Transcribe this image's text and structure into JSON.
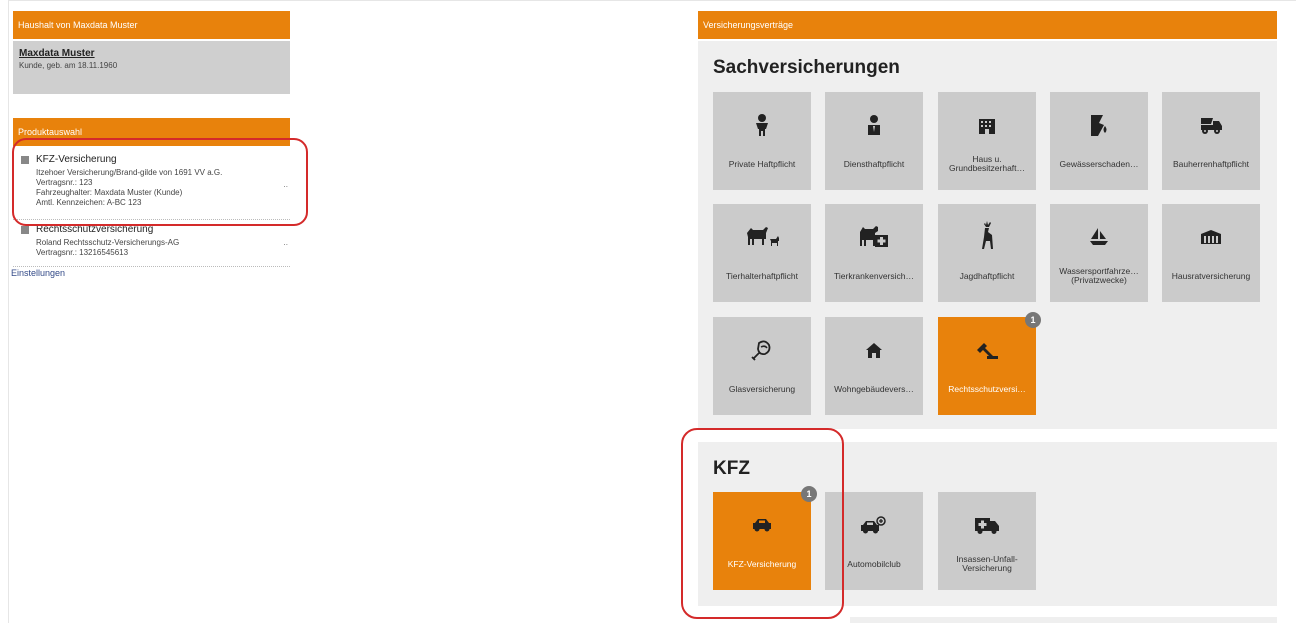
{
  "household_header": "Haushalt von Maxdata Muster",
  "customer": {
    "name": "Maxdata Muster",
    "subtitle": "Kunde, geb. am 18.11.1960"
  },
  "product_header": "Produktauswahl",
  "products": [
    {
      "title": "KFZ-Versicherung",
      "lines": [
        "Itzehoer Versicherung/Brand-gilde von 1691 VV a.G.",
        "Vertragsnr.: 123",
        "Fahrzeughalter: Maxdata Muster (Kunde)",
        "Amtl. Kennzeichen: A-BC 123"
      ],
      "more": ".."
    },
    {
      "title": "Rechtsschutzversicherung",
      "lines": [
        "Roland Rechtsschutz-Versicherungs-AG",
        "Vertragsnr.: 13216545613"
      ],
      "more": ".."
    }
  ],
  "settings_link": "Einstellungen",
  "contracts_header": "Versicherungsverträge",
  "sections": [
    {
      "title": "Sachversicherungen",
      "tiles": [
        {
          "label": "Private Haftpflicht",
          "icon": "person-icon"
        },
        {
          "label": "Diensthaftpflicht",
          "icon": "employee-icon"
        },
        {
          "label": "Haus u. Grundbesitzerhaft…",
          "icon": "building-icon"
        },
        {
          "label": "Gewässerschaden…",
          "icon": "water-damage-icon"
        },
        {
          "label": "Bauherrenhaftpflicht",
          "icon": "construction-truck-icon"
        },
        {
          "label": "Tierhalterhaftpflicht",
          "icon": "horse-dog-icon"
        },
        {
          "label": "Tierkrankenversich…",
          "icon": "pet-medical-icon"
        },
        {
          "label": "Jagdhaftpflicht",
          "icon": "deer-icon"
        },
        {
          "label": "Wassersportfahrze… (Privatzwecke)",
          "icon": "sailboat-icon"
        },
        {
          "label": "Hausratversicherung",
          "icon": "furniture-icon"
        },
        {
          "label": "Glasversicherung",
          "icon": "broken-glass-icon"
        },
        {
          "label": "Wohngebäudevers…",
          "icon": "home-icon"
        },
        {
          "label": "Rechtsschutzversi…",
          "icon": "gavel-icon",
          "active": true,
          "badge": "1"
        }
      ]
    },
    {
      "title": "KFZ",
      "tiles": [
        {
          "label": "KFZ-Versicherung",
          "icon": "car-icon",
          "active": true,
          "badge": "1"
        },
        {
          "label": "Automobilclub",
          "icon": "car-plus-icon"
        },
        {
          "label": "Insassen-Unfall-Versicherung",
          "icon": "ambulance-icon"
        }
      ]
    }
  ],
  "colors": {
    "accent": "#e8820c",
    "tile": "#cbcbcb",
    "section": "#efefef",
    "highlight": "#d42a2a"
  }
}
